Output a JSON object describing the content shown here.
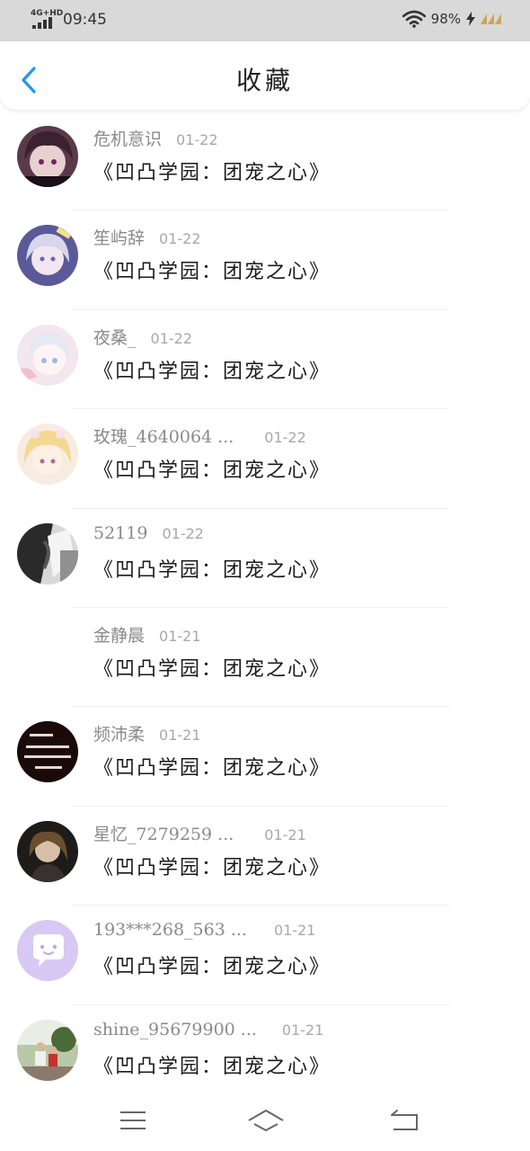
{
  "status_bar": {
    "network": "4G+HD",
    "time": "09:45",
    "battery": "98%"
  },
  "header": {
    "title": "收藏",
    "back_icon": "chevron-left-icon"
  },
  "colors": {
    "accent": "#2196f3",
    "status_bar_bg": "#d9d9d9",
    "name_text": "#8a8a8a",
    "title_text": "#1a1a1a"
  },
  "items": [
    {
      "name": "危机意识",
      "date": "01-22",
      "title": "《凹凸学园：团宠之心》",
      "avatar": "avatar-anime-dark"
    },
    {
      "name": "笙屿辞",
      "date": "01-22",
      "title": "《凹凸学园：团宠之心》",
      "avatar": "avatar-anime-blue"
    },
    {
      "name": "夜桑_",
      "date": "01-22",
      "title": "《凹凸学园：团宠之心》",
      "avatar": "avatar-anime-pink"
    },
    {
      "name": "玫瑰_4640064 ...",
      "date": "01-22",
      "title": "《凹凸学园：团宠之心》",
      "avatar": "avatar-anime-gold"
    },
    {
      "name": "52119",
      "date": "01-22",
      "title": "《凹凸学园：团宠之心》",
      "avatar": "avatar-monochrome"
    },
    {
      "name": "金静晨",
      "date": "01-21",
      "title": "《凹凸学园：团宠之心》",
      "avatar": "avatar-empty"
    },
    {
      "name": "频沛柔",
      "date": "01-21",
      "title": "《凹凸学园：团宠之心》",
      "avatar": "avatar-text-dark"
    },
    {
      "name": "星忆_7279259 ...",
      "date": "01-21",
      "title": "《凹凸学园：团宠之心》",
      "avatar": "avatar-portrait-dark"
    },
    {
      "name": "193***268_563 ...",
      "date": "01-21",
      "title": "《凹凸学园：团宠之心》",
      "avatar": "avatar-default-chat"
    },
    {
      "name": "shine_95679900 ...",
      "date": "01-21",
      "title": "《凹凸学园：团宠之心》",
      "avatar": "avatar-photo-outdoor"
    }
  ],
  "nav_bar": {
    "menu_icon": "menu-icon",
    "home_icon": "home-icon",
    "back_icon": "back-icon"
  }
}
